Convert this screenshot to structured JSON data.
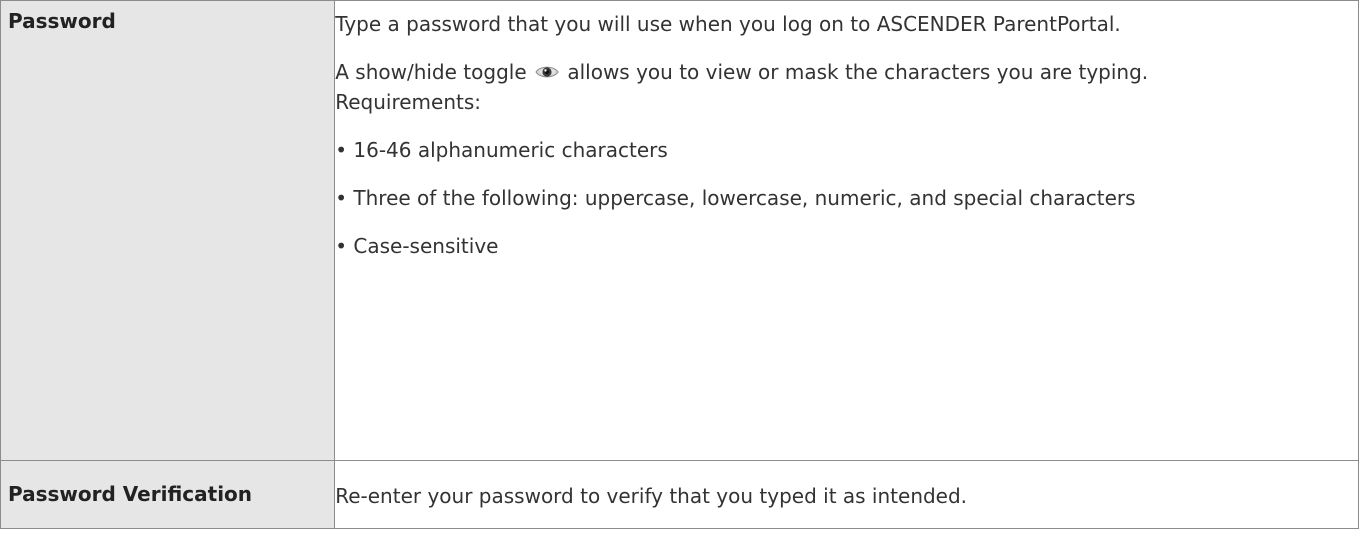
{
  "table": {
    "rows": [
      {
        "field": "Password",
        "intro": "Type a password that you will use when you log on to ASCENDER ParentPortal.",
        "toggle_before": "A show/hide toggle",
        "toggle_icon": "eye-icon",
        "toggle_after": "allows you to view or mask the characters you are typing.",
        "requirements_label": "Requirements:",
        "requirements": [
          "• 16-46 alphanumeric characters",
          "• Three of the following: uppercase, lowercase, numeric, and special characters",
          "• Case-sensitive"
        ]
      },
      {
        "field": "Password Verification",
        "description": "Re-enter your password to verify that you typed it as intended."
      }
    ]
  },
  "colors": {
    "header_cell_bg": "#e6e6e6",
    "border": "#8c8c8c",
    "text": "#333333"
  }
}
